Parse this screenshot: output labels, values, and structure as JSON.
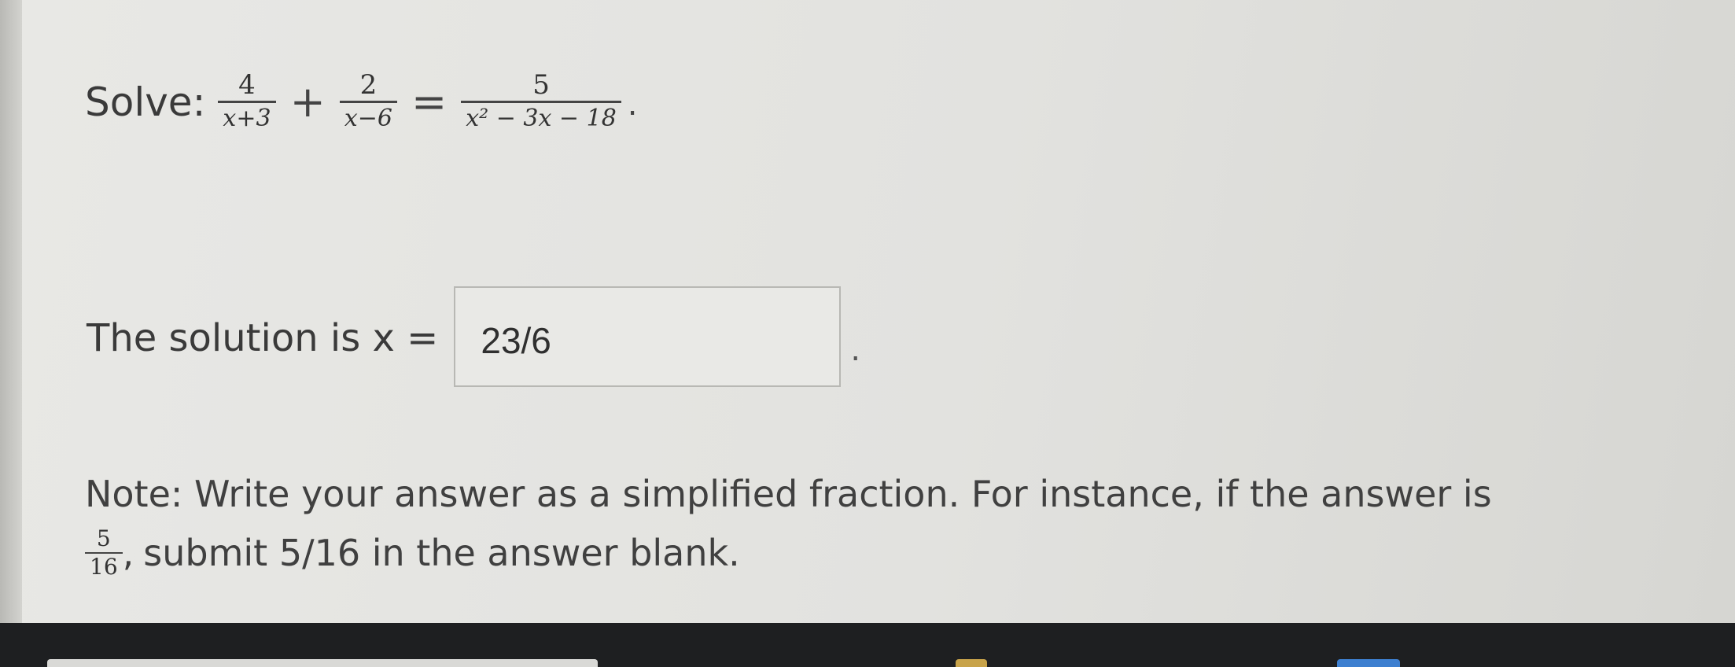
{
  "problem": {
    "label": "Solve:",
    "term1": {
      "numerator": "4",
      "denominator": "x+3"
    },
    "plus": "+",
    "term2": {
      "numerator": "2",
      "denominator": "x−6"
    },
    "equals": "=",
    "term3": {
      "numerator": "5",
      "denominator": "x² − 3x − 18"
    },
    "period": "."
  },
  "answer": {
    "label": "The solution is x =",
    "value": "23/6",
    "period": "."
  },
  "note": {
    "line1": "Note: Write your answer as a simplified fraction. For instance, if the answer is",
    "example_fraction": {
      "numerator": "5",
      "denominator": "16"
    },
    "comma": ",",
    "line2": "submit 5/16 in the answer blank."
  },
  "colors": {
    "background": "#e5e5e2",
    "text": "#3a3a3a",
    "bezel": "#1e1f21"
  }
}
